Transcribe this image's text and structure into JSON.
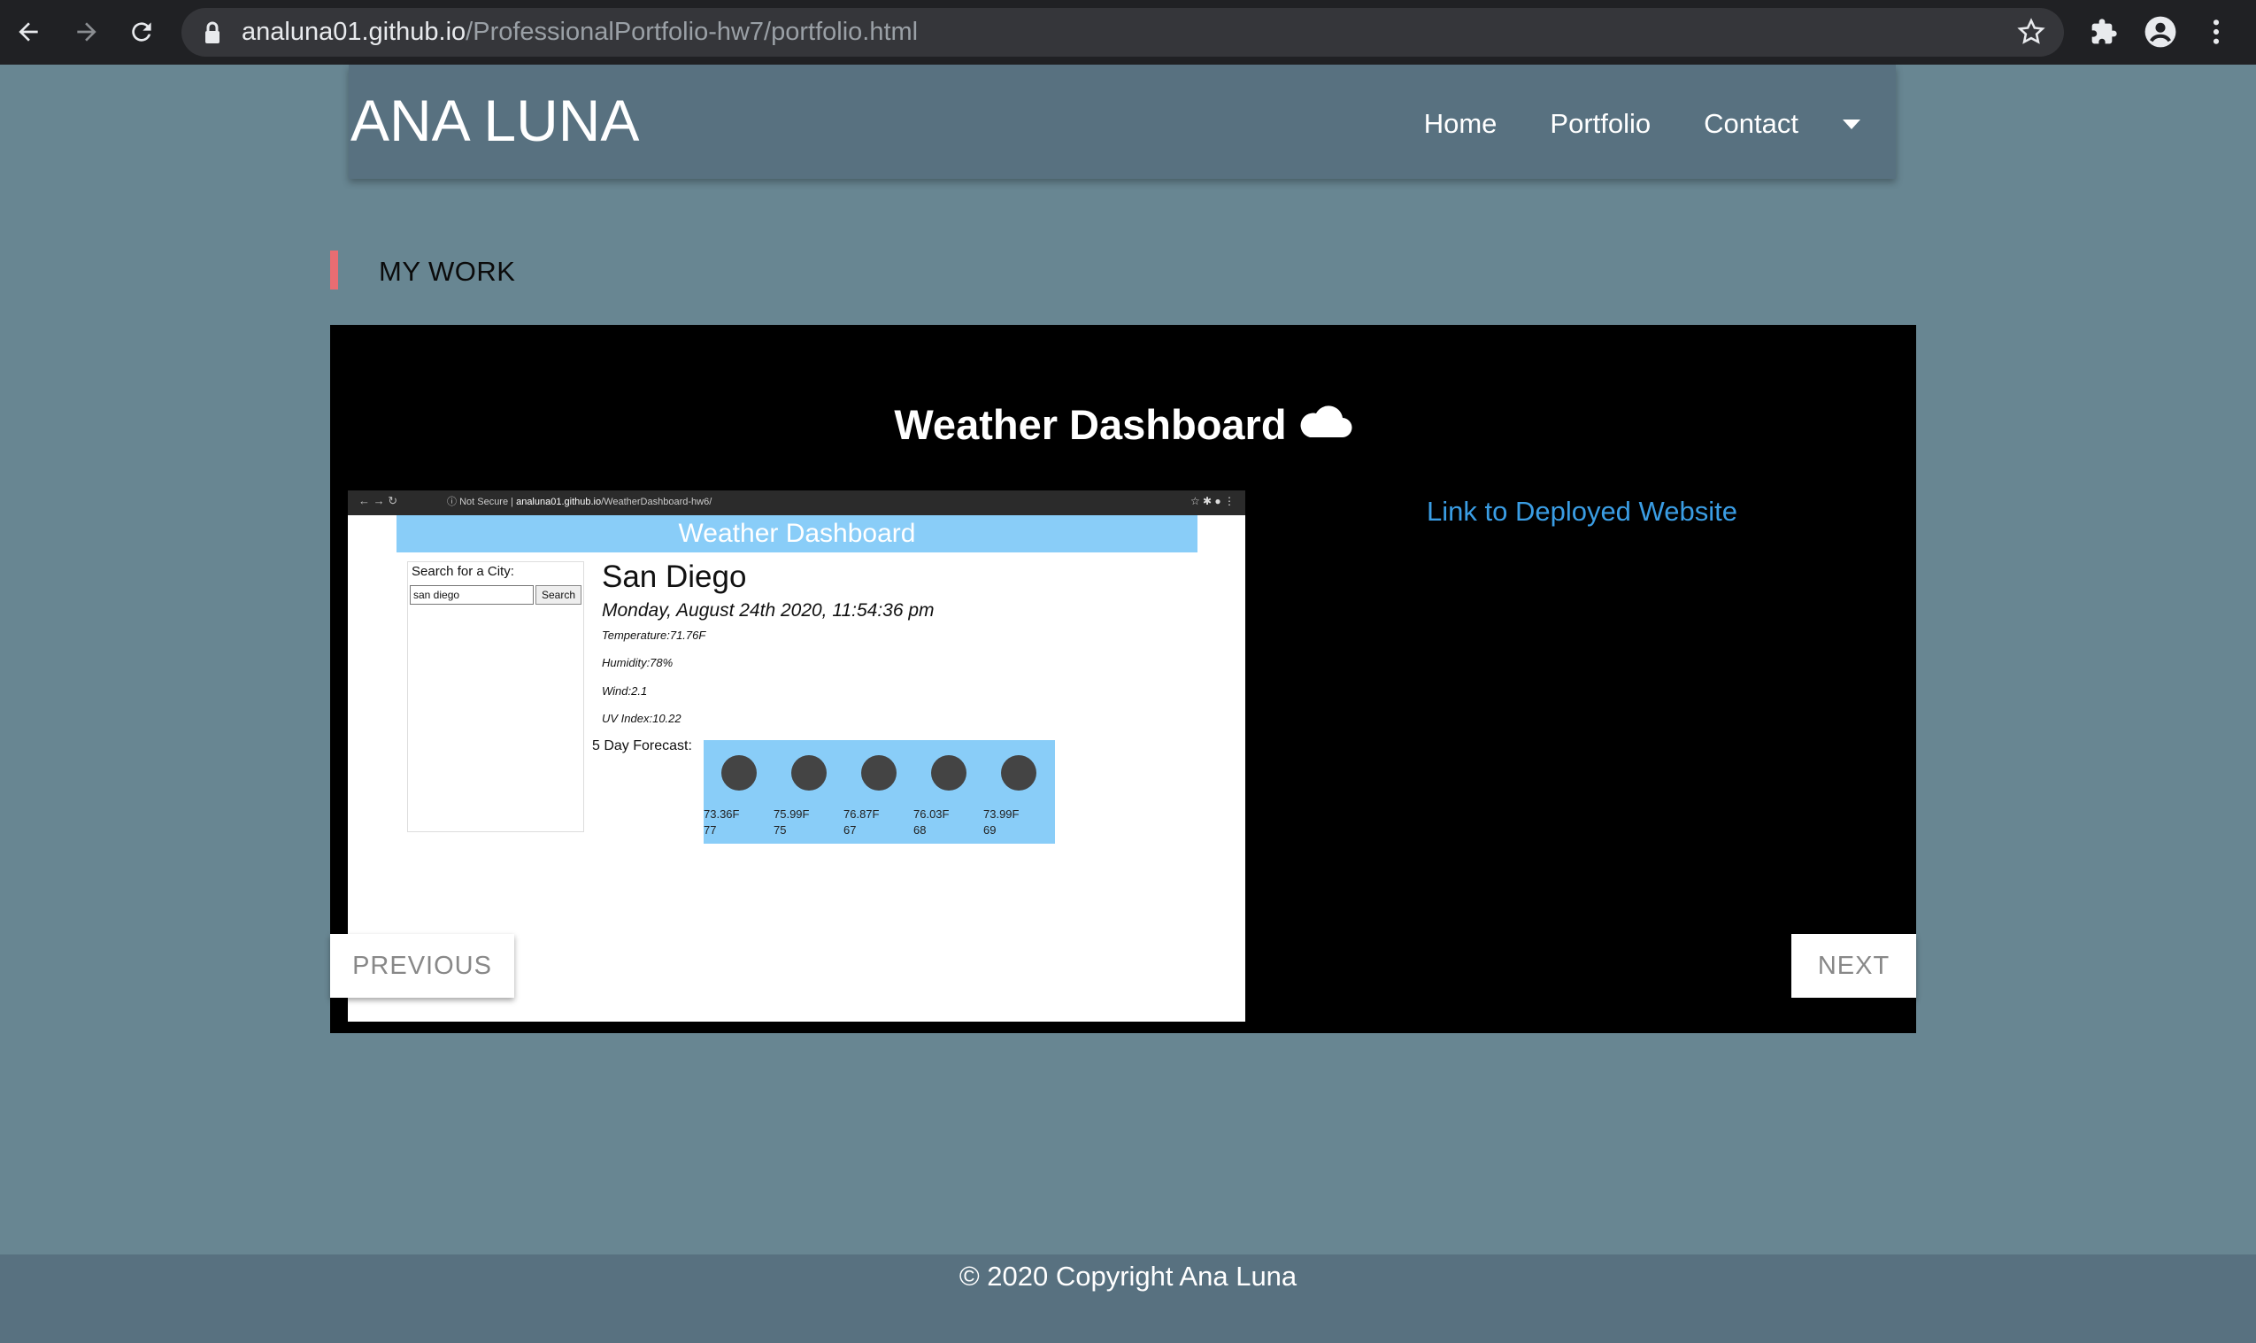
{
  "browser": {
    "url_host": "analuna01.github.io",
    "url_path": "/ProfessionalPortfolio-hw7/portfolio.html"
  },
  "header": {
    "brand": "ANA LUNA",
    "nav": [
      "Home",
      "Portfolio",
      "Contact"
    ]
  },
  "section": {
    "title": "MY WORK",
    "accent_color": "#e86d72"
  },
  "carousel": {
    "slide_title": "Weather Dashboard",
    "link_text": "Link to Deployed Website",
    "prev_label": "PREVIOUS",
    "next_label": "NEXT",
    "screenshot": {
      "security": "Not Secure",
      "url_host": "analuna01.github.io",
      "url_path": "/WeatherDashboard-hw6/",
      "banner": "Weather Dashboard",
      "search_label": "Search for a City:",
      "search_value": "san diego",
      "search_button": "Search",
      "city": "San Diego",
      "date": "Monday, August 24th 2020, 11:54:36 pm",
      "stats": [
        "Temperature:71.76F",
        "Humidity:78%",
        "Wind:2.1",
        "UV Index:10.22"
      ],
      "forecast_label": "5 Day Forecast:",
      "forecast": [
        {
          "temp": "73.36F",
          "humidity": "77"
        },
        {
          "temp": "75.99F",
          "humidity": "75"
        },
        {
          "temp": "76.87F",
          "humidity": "67"
        },
        {
          "temp": "76.03F",
          "humidity": "68"
        },
        {
          "temp": "73.99F",
          "humidity": "69"
        }
      ]
    }
  },
  "footer": {
    "text": "© 2020 Copyright Ana Luna"
  },
  "colors": {
    "page_bg": "#688692",
    "header_bg": "#587180",
    "link": "#3a9de4"
  }
}
